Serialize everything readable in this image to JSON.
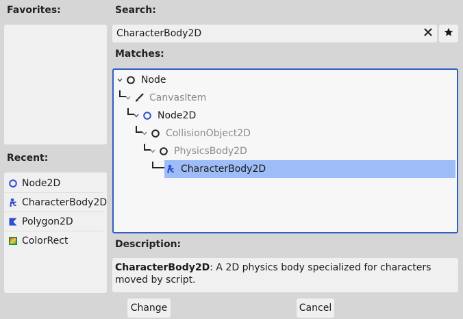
{
  "favorites": {
    "label": "Favorites:"
  },
  "recent": {
    "label": "Recent:",
    "items": [
      {
        "label": "Node2D",
        "icon": "node2d-icon"
      },
      {
        "label": "CharacterBody2D",
        "icon": "characterbody2d-icon"
      },
      {
        "label": "Polygon2D",
        "icon": "polygon2d-icon"
      },
      {
        "label": "ColorRect",
        "icon": "colorrect-icon"
      }
    ]
  },
  "search": {
    "label": "Search:",
    "value": "CharacterBody2D",
    "clear_icon": "close-icon",
    "favorite_icon": "star-icon"
  },
  "matches": {
    "label": "Matches:",
    "rows": [
      {
        "label": "Node",
        "icon": "node-icon",
        "dimmed": false,
        "selected": false
      },
      {
        "label": "CanvasItem",
        "icon": "canvasitem-icon",
        "dimmed": true,
        "selected": false
      },
      {
        "label": "Node2D",
        "icon": "node2d-icon",
        "dimmed": false,
        "selected": false
      },
      {
        "label": "CollisionObject2D",
        "icon": "collisionobject2d-icon",
        "dimmed": true,
        "selected": false
      },
      {
        "label": "PhysicsBody2D",
        "icon": "physicsbody2d-icon",
        "dimmed": true,
        "selected": false
      },
      {
        "label": "CharacterBody2D",
        "icon": "characterbody2d-icon",
        "dimmed": false,
        "selected": true
      }
    ]
  },
  "description": {
    "label": "Description:",
    "name": "CharacterBody2D",
    "text": ": A 2D physics body specialized for characters moved by script."
  },
  "buttons": {
    "change": "Change",
    "cancel": "Cancel"
  },
  "colors": {
    "accent": "#2f5fc4",
    "selection": "#9ebcf7",
    "node2d_blue": "#2f4fd0"
  }
}
